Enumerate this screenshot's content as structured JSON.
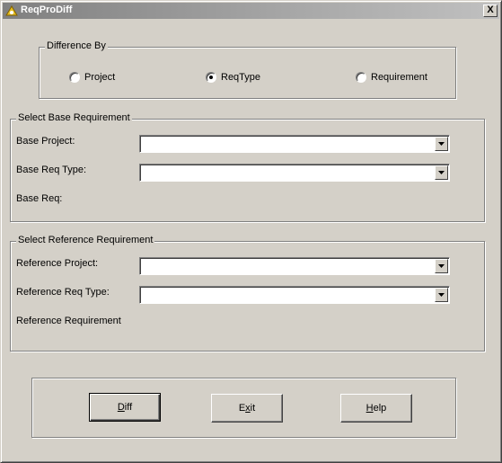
{
  "window": {
    "title": "ReqProDiff",
    "close_label": "X"
  },
  "difference_by": {
    "label": "Difference By",
    "options": [
      {
        "label": "Project",
        "selected": false
      },
      {
        "label": "ReqType",
        "selected": true
      },
      {
        "label": "Requirement",
        "selected": false
      }
    ]
  },
  "base": {
    "label": "Select Base Requirement",
    "project_label": "Base Project:",
    "project_value": "",
    "reqtype_label": "Base Req Type:",
    "reqtype_value": "",
    "req_label": "Base Req:"
  },
  "reference": {
    "label": "Select Reference Requirement",
    "project_label": "Reference Project:",
    "project_value": "",
    "reqtype_label": "Reference Req Type:",
    "reqtype_value": "",
    "req_label": "Reference Requirement"
  },
  "buttons": {
    "diff": {
      "accel": "D",
      "rest": "iff"
    },
    "exit": {
      "pre": "E",
      "accel": "x",
      "rest": "it"
    },
    "help": {
      "accel": "H",
      "rest": "elp"
    }
  }
}
